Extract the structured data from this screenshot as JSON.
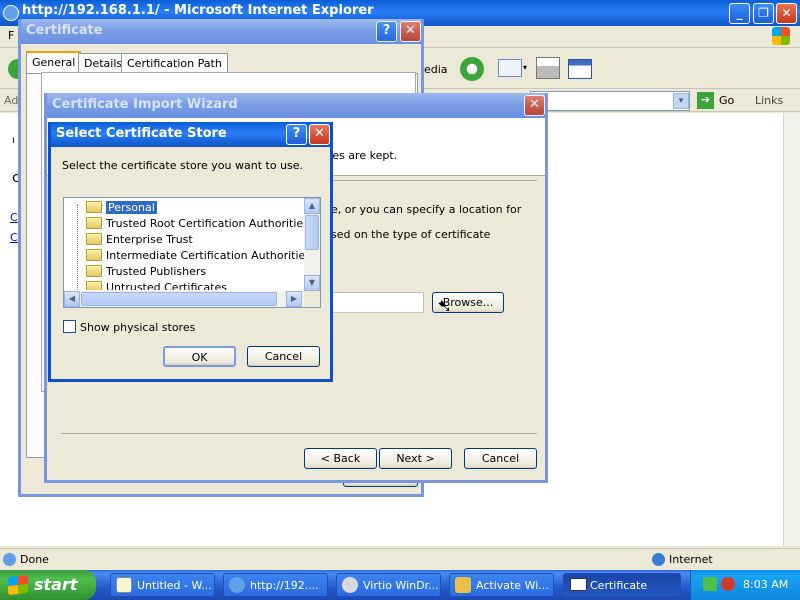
{
  "ie": {
    "title": "http://192.168.1.1/ - Microsoft Internet Explorer",
    "menu_first": "F",
    "address_label": "Ad",
    "go_label": "Go",
    "links_label": "Links",
    "toolbar_media": "edia",
    "status": "Done",
    "zone": "Internet"
  },
  "cert_dialog": {
    "title": "Certificate",
    "tabs": [
      "General",
      "Details",
      "Certification Path"
    ]
  },
  "wizard": {
    "title": "Certificate Import Wizard",
    "text1": "tes are kept.",
    "text2": "e, or you can specify a location for",
    "text3": "sed on the type of certificate",
    "browse": "Browse...",
    "back": "< Back",
    "next": "Next >",
    "cancel": "Cancel"
  },
  "store_dialog": {
    "title": "Select Certificate Store",
    "prompt": "Select the certificate store you want to use.",
    "stores": [
      "Personal",
      "Trusted Root Certification Authorities",
      "Enterprise Trust",
      "Intermediate Certification Authorities",
      "Trusted Publishers",
      "Untrusted Certificates"
    ],
    "selected_index": 0,
    "show_physical": "Show physical stores",
    "show_physical_checked": false,
    "ok": "OK",
    "cancel": "Cancel"
  },
  "taskbar": {
    "start": "start",
    "tasks": [
      "Untitled - W...",
      "http://192....",
      "Virtio WinDr...",
      "Activate Wi...",
      "Certificate"
    ],
    "active_index": 4,
    "clock": "8:03 AM"
  }
}
